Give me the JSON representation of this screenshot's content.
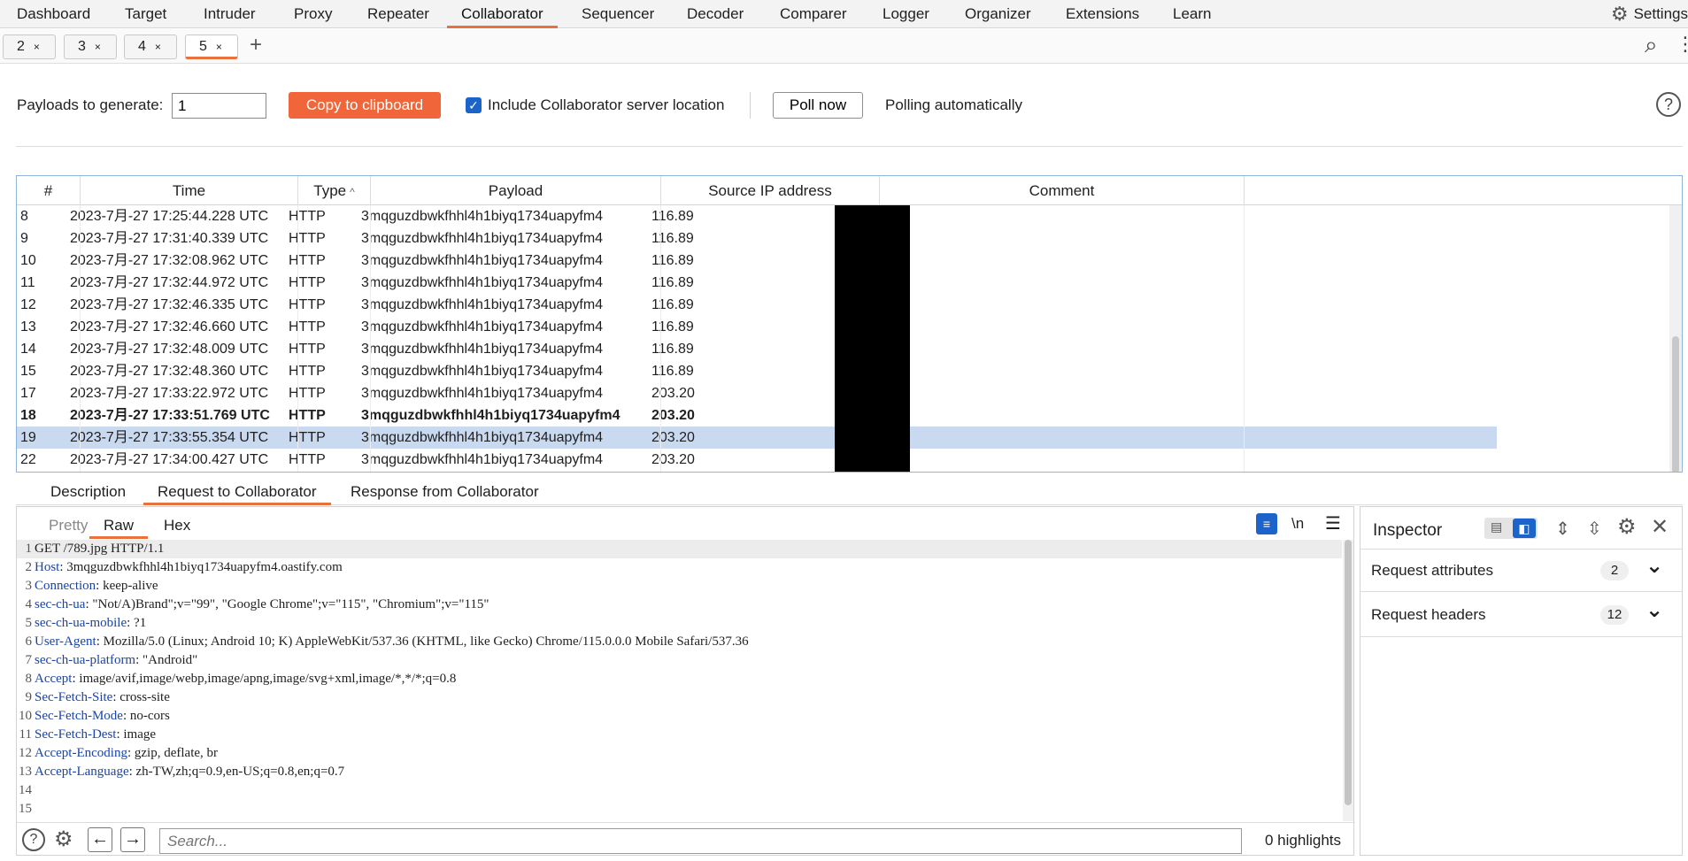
{
  "nav": {
    "items": [
      "Dashboard",
      "Target",
      "Intruder",
      "Proxy",
      "Repeater",
      "Collaborator",
      "Sequencer",
      "Decoder",
      "Comparer",
      "Logger",
      "Organizer",
      "Extensions",
      "Learn"
    ],
    "active": "Collaborator",
    "settings_label": "Settings"
  },
  "subtabs": [
    {
      "label": "2",
      "close": "×"
    },
    {
      "label": "3",
      "close": "×"
    },
    {
      "label": "4",
      "close": "×"
    },
    {
      "label": "5",
      "close": "×",
      "active": true
    }
  ],
  "subtabs_add": "+",
  "controls": {
    "payloads_label": "Payloads to generate:",
    "payloads_value": "1",
    "copy_button": "Copy to clipboard",
    "include_location_label": "Include Collaborator server location",
    "include_location_checked": true,
    "poll_button": "Poll now",
    "polling_status": "Polling automatically"
  },
  "table": {
    "columns": [
      "#",
      "Time",
      "Type",
      "Payload",
      "Source IP address",
      "Comment"
    ],
    "sort_indicator": "^",
    "rows": [
      {
        "n": "8",
        "time": "2023-7月-27 17:25:44.228 UTC",
        "type": "HTTP",
        "payload": "3mqguzdbwkfhhl4h1biyq1734uapyfm4",
        "ip": "116.89",
        "comment": ""
      },
      {
        "n": "9",
        "time": "2023-7月-27 17:31:40.339 UTC",
        "type": "HTTP",
        "payload": "3mqguzdbwkfhhl4h1biyq1734uapyfm4",
        "ip": "116.89",
        "comment": ""
      },
      {
        "n": "10",
        "time": "2023-7月-27 17:32:08.962 UTC",
        "type": "HTTP",
        "payload": "3mqguzdbwkfhhl4h1biyq1734uapyfm4",
        "ip": "116.89",
        "comment": ""
      },
      {
        "n": "11",
        "time": "2023-7月-27 17:32:44.972 UTC",
        "type": "HTTP",
        "payload": "3mqguzdbwkfhhl4h1biyq1734uapyfm4",
        "ip": "116.89",
        "comment": ""
      },
      {
        "n": "12",
        "time": "2023-7月-27 17:32:46.335 UTC",
        "type": "HTTP",
        "payload": "3mqguzdbwkfhhl4h1biyq1734uapyfm4",
        "ip": "116.89",
        "comment": ""
      },
      {
        "n": "13",
        "time": "2023-7月-27 17:32:46.660 UTC",
        "type": "HTTP",
        "payload": "3mqguzdbwkfhhl4h1biyq1734uapyfm4",
        "ip": "116.89",
        "comment": ""
      },
      {
        "n": "14",
        "time": "2023-7月-27 17:32:48.009 UTC",
        "type": "HTTP",
        "payload": "3mqguzdbwkfhhl4h1biyq1734uapyfm4",
        "ip": "116.89",
        "comment": ""
      },
      {
        "n": "15",
        "time": "2023-7月-27 17:32:48.360 UTC",
        "type": "HTTP",
        "payload": "3mqguzdbwkfhhl4h1biyq1734uapyfm4",
        "ip": "116.89",
        "comment": ""
      },
      {
        "n": "17",
        "time": "2023-7月-27 17:33:22.972 UTC",
        "type": "HTTP",
        "payload": "3mqguzdbwkfhhl4h1biyq1734uapyfm4",
        "ip": "203.20",
        "comment": ""
      },
      {
        "n": "18",
        "time": "2023-7月-27 17:33:51.769 UTC",
        "type": "HTTP",
        "payload": "3mqguzdbwkfhhl4h1biyq1734uapyfm4",
        "ip": "203.20",
        "comment": "",
        "bold": true
      },
      {
        "n": "19",
        "time": "2023-7月-27 17:33:55.354 UTC",
        "type": "HTTP",
        "payload": "3mqguzdbwkfhhl4h1biyq1734uapyfm4",
        "ip": "203.20",
        "comment": "",
        "selected": true
      },
      {
        "n": "22",
        "time": "2023-7月-27 17:34:00.427 UTC",
        "type": "HTTP",
        "payload": "3mqguzdbwkfhhl4h1biyq1734uapyfm4",
        "ip": "203.20",
        "comment": ""
      }
    ]
  },
  "message_tabs": [
    "Description",
    "Request to Collaborator",
    "Response from Collaborator"
  ],
  "message_tabs_active": "Request to Collaborator",
  "editor": {
    "tabs": [
      "Pretty",
      "Raw",
      "Hex"
    ],
    "active_tab": "Raw",
    "newline_toggle": "\\n",
    "lines": [
      {
        "key": "",
        "val": "GET /789.jpg HTTP/1.1"
      },
      {
        "key": "Host",
        "val": ": 3mqguzdbwkfhhl4h1biyq1734uapyfm4.oastify.com"
      },
      {
        "key": "Connection",
        "val": ": keep-alive"
      },
      {
        "key": "sec-ch-ua",
        "val": ": \"Not/A)Brand\";v=\"99\", \"Google Chrome\";v=\"115\", \"Chromium\";v=\"115\""
      },
      {
        "key": "sec-ch-ua-mobile",
        "val": ": ?1"
      },
      {
        "key": "User-Agent",
        "val": ": Mozilla/5.0 (Linux; Android 10; K) AppleWebKit/537.36 (KHTML, like Gecko) Chrome/115.0.0.0 Mobile Safari/537.36"
      },
      {
        "key": "sec-ch-ua-platform",
        "val": ": \"Android\""
      },
      {
        "key": "Accept",
        "val": ": image/avif,image/webp,image/apng,image/svg+xml,image/*,*/*;q=0.8"
      },
      {
        "key": "Sec-Fetch-Site",
        "val": ": cross-site"
      },
      {
        "key": "Sec-Fetch-Mode",
        "val": ": no-cors"
      },
      {
        "key": "Sec-Fetch-Dest",
        "val": ": image"
      },
      {
        "key": "Accept-Encoding",
        "val": ": gzip, deflate, br"
      },
      {
        "key": "Accept-Language",
        "val": ": zh-TW,zh;q=0.9,en-US;q=0.8,en;q=0.7"
      },
      {
        "key": "",
        "val": ""
      },
      {
        "key": "",
        "val": ""
      }
    ],
    "search_placeholder": "Search...",
    "highlights": "0 highlights"
  },
  "inspector": {
    "title": "Inspector",
    "sections": [
      {
        "label": "Request attributes",
        "count": "2"
      },
      {
        "label": "Request headers",
        "count": "12"
      }
    ]
  },
  "colors": {
    "accent": "#e8713e",
    "selection": "#c9d9f0",
    "header_key": "#1a44a8",
    "checkbox": "#1c64c9"
  }
}
